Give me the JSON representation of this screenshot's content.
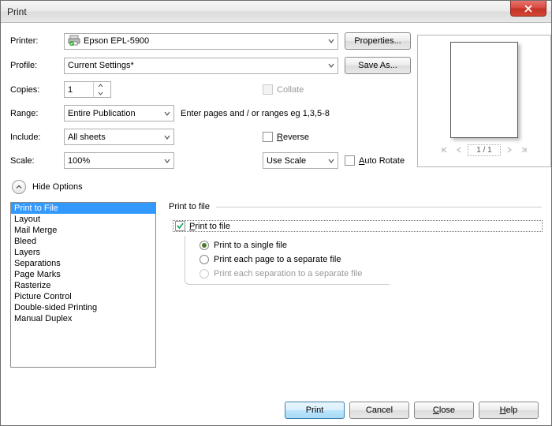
{
  "window": {
    "title": "Print"
  },
  "labels": {
    "printer": "Printer:",
    "profile": "Profile:",
    "copies": "Copies:",
    "range": "Range:",
    "include": "Include:",
    "scale": "Scale:"
  },
  "fields": {
    "printer": "Epson EPL-5900",
    "profile": "Current Settings*",
    "copies": "1",
    "range": "Entire Publication",
    "include": "All sheets",
    "scale": "100%",
    "scaleMode": "Use Scale"
  },
  "buttons": {
    "properties": "Properties...",
    "saveAs": "Save As...",
    "hideOptions": "Hide Options",
    "print": "Print",
    "cancel": "Cancel",
    "close": "Close",
    "help": "Help"
  },
  "checkboxes": {
    "collate": "Collate",
    "reverse": "Reverse",
    "autoRotate": "Auto Rotate",
    "printToFile": "Print to file"
  },
  "hints": {
    "rangeHint": "Enter pages and / or ranges eg 1,3,5-8"
  },
  "preview": {
    "pageIndicator": "1 / 1"
  },
  "sidebar": {
    "items": [
      "Print to File",
      "Layout",
      "Mail Merge",
      "Bleed",
      "Layers",
      "Separations",
      "Page Marks",
      "Rasterize",
      "Picture Control",
      "Double-sided Printing",
      "Manual Duplex"
    ],
    "selectedIndex": 0
  },
  "panel": {
    "title": "Print to file",
    "radios": {
      "single": "Print to a single file",
      "each": "Print each page to a separate file",
      "sep": "Print each separation to a separate file"
    }
  }
}
